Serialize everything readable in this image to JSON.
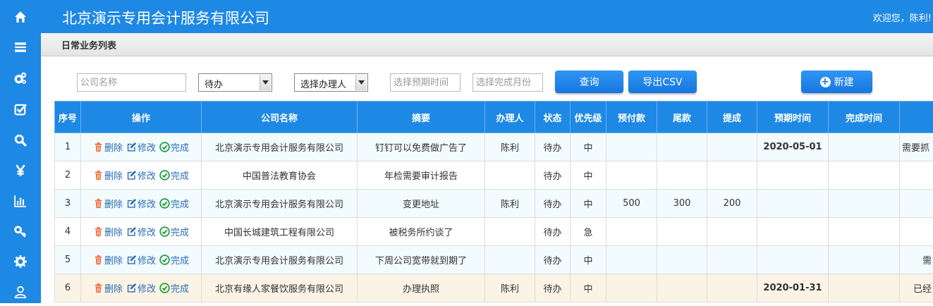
{
  "header": {
    "company": "北京演示专用会计服务有限公司",
    "welcome": "欢迎您，陈利!"
  },
  "page_title": "日常业务列表",
  "sidebar": {
    "icons": [
      "home-icon",
      "list-icon",
      "cogs-icon",
      "check-square-icon",
      "search-icon",
      "yen-icon",
      "bar-chart-icon",
      "key-icon",
      "gear-icon",
      "user-icon"
    ],
    "color": "#1e88e5"
  },
  "filters": {
    "company_placeholder": "公司名称",
    "status_value": "待办",
    "handler_value": "选择办理人",
    "expected_placeholder": "选择预期时间",
    "month_placeholder": "选择完成月份"
  },
  "buttons": {
    "query": "查询",
    "export": "导出CSV",
    "new": "新建"
  },
  "table": {
    "headers": [
      "序号",
      "操作",
      "公司名称",
      "摘要",
      "办理人",
      "状态",
      "优先级",
      "预付款",
      "尾款",
      "提成",
      "预期时间",
      "完成时间",
      ""
    ],
    "actions": {
      "delete": "删除",
      "edit": "修改",
      "done": "完成"
    },
    "rows": [
      {
        "no": "1",
        "company": "北京演示专用会计服务有限公司",
        "summary": "钉钉可以免费做广告了",
        "handler": "陈利",
        "status": "待办",
        "priority": "中",
        "prepay": "",
        "balance": "",
        "commission": "",
        "expected": "2020-05-01",
        "finished": "",
        "note": "需要抓"
      },
      {
        "no": "2",
        "company": "中国普法教育协会",
        "summary": "年检需要审计报告",
        "handler": "",
        "status": "待办",
        "priority": "中",
        "prepay": "",
        "balance": "",
        "commission": "",
        "expected": "",
        "finished": "",
        "note": ""
      },
      {
        "no": "3",
        "company": "北京演示专用会计服务有限公司",
        "summary": "变更地址",
        "handler": "陈利",
        "status": "待办",
        "priority": "中",
        "prepay": "500",
        "balance": "300",
        "commission": "200",
        "expected": "",
        "finished": "",
        "note": ""
      },
      {
        "no": "4",
        "company": "中国长城建筑工程有限公司",
        "summary": "被税务所约谈了",
        "handler": "",
        "status": "待办",
        "priority": "急",
        "prepay": "",
        "balance": "",
        "commission": "",
        "expected": "",
        "finished": "",
        "note": ""
      },
      {
        "no": "5",
        "company": "北京演示专用会计服务有限公司",
        "summary": "下周公司宽带就到期了",
        "handler": "",
        "status": "待办",
        "priority": "中",
        "prepay": "",
        "balance": "",
        "commission": "",
        "expected": "",
        "finished": "",
        "note": "需"
      },
      {
        "no": "6",
        "company": "北京有缘人家餐饮服务有限公司",
        "summary": "办理执照",
        "handler": "陈利",
        "status": "待办",
        "priority": "中",
        "prepay": "",
        "balance": "",
        "commission": "",
        "expected": "2020-01-31",
        "finished": "",
        "note": "已经"
      }
    ]
  },
  "colors": {
    "primary": "#1e88e5",
    "urgent": "#e4393c",
    "date_red": "#d9161c"
  }
}
